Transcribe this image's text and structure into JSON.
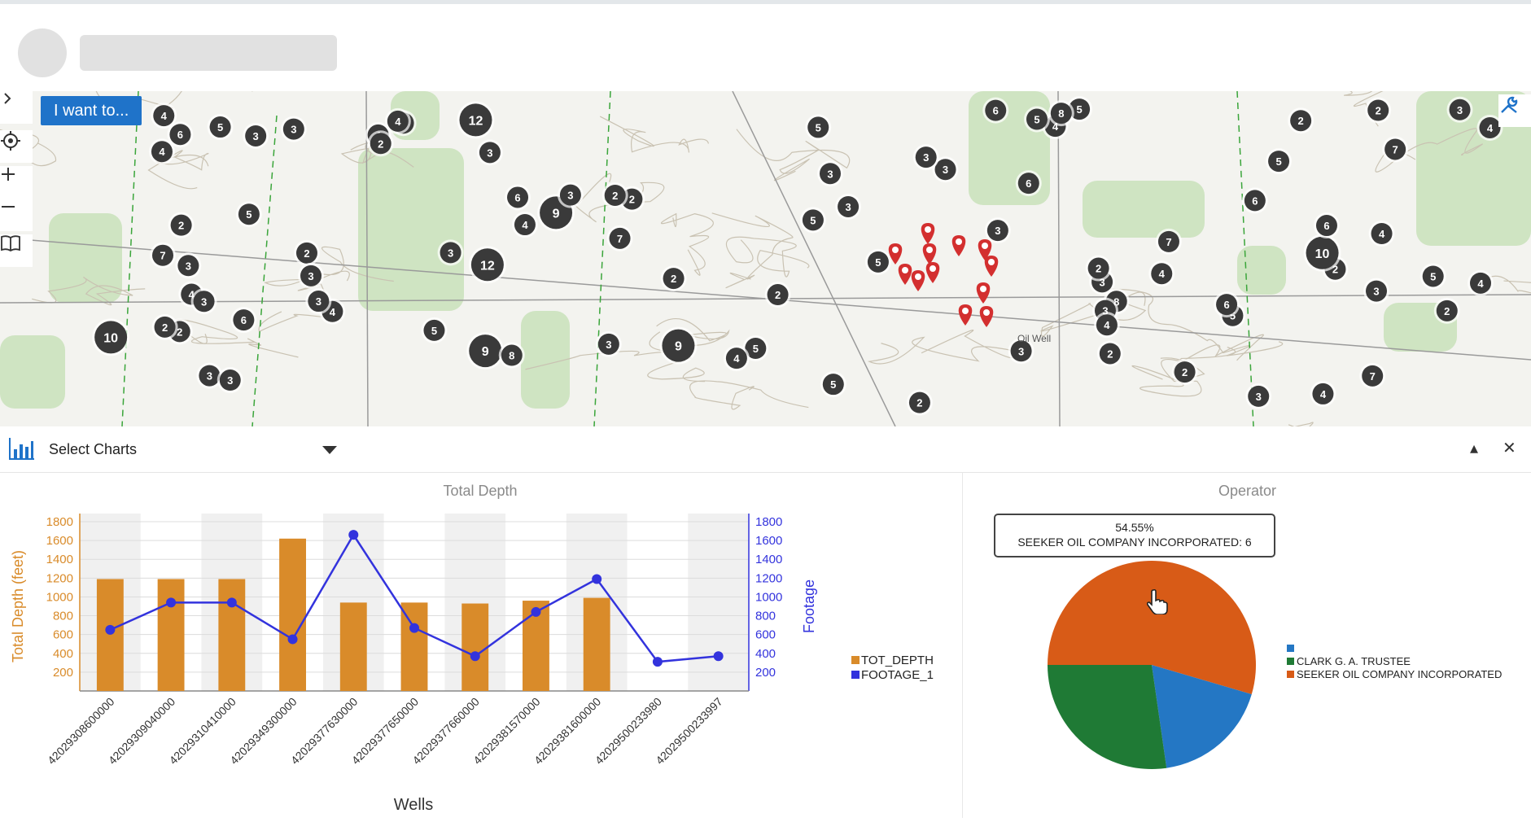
{
  "map": {
    "button_label": "I want to...",
    "expand_icon": "chevron-right-icon",
    "locate_icon": "locate-icon",
    "zoom_in_icon": "plus-icon",
    "zoom_out_icon": "minus-icon",
    "bookmark_icon": "book-icon",
    "tools_icon": "tools-icon",
    "clusters": [
      "3",
      "2",
      "3",
      "4",
      "2",
      "2",
      "2",
      "4",
      "6",
      "2",
      "4",
      "7",
      "6",
      "7",
      "3",
      "4",
      "2",
      "5",
      "2",
      "4",
      "3",
      "2",
      "4",
      "3",
      "6",
      "4",
      "8",
      "3",
      "2",
      "7",
      "5",
      "3",
      "9",
      "12",
      "10",
      "5",
      "3",
      "2",
      "5",
      "6",
      "7",
      "5",
      "4",
      "9",
      "6",
      "5",
      "10",
      "5",
      "3",
      "2",
      "4",
      "3",
      "2",
      "2",
      "4",
      "3",
      "6",
      "4",
      "3",
      "3",
      "4",
      "3",
      "3",
      "4",
      "5",
      "5",
      "2",
      "3",
      "3",
      "2",
      "3",
      "12",
      "7",
      "3",
      "5",
      "8",
      "3",
      "9",
      "8",
      "5",
      "2",
      "3",
      "5",
      "6",
      "6",
      "5",
      "4",
      "4",
      "4",
      "3",
      "2",
      "3"
    ],
    "clusters_note": "cluster badge counts shown on map",
    "label_oil_well": "Oil Well"
  },
  "toolbar": {
    "select_label": "Select Charts",
    "minimize": "▴",
    "close": "✕"
  },
  "colors": {
    "accent_blue": "#1f73c9",
    "bar_orange": "#d98b2a",
    "line_blue": "#3333dd",
    "pie_orange": "#d85b17",
    "pie_green": "#1f7a35",
    "pie_blue": "#2477c4"
  },
  "chart_data": [
    {
      "type": "bar",
      "title": "Total Depth",
      "xlabel": "Wells",
      "ylabel": "Total Depth (feet)",
      "y2label": "Footage",
      "ylim": [
        0,
        1800
      ],
      "y2lim": [
        0,
        1800
      ],
      "yticks": [
        "200",
        "400",
        "600",
        "800",
        "1000",
        "1200",
        "1400",
        "1600",
        "1800"
      ],
      "categories": [
        "42029308600000",
        "42029309040000",
        "42029310410000",
        "42029349300000",
        "42029377630000",
        "42029377650000",
        "42029377660000",
        "42029381570000",
        "42029381600000",
        "42029500233980",
        "42029500233997"
      ],
      "series": [
        {
          "name": "TOT_DEPTH",
          "kind": "bar",
          "values": [
            1190,
            1190,
            1190,
            1620,
            940,
            940,
            930,
            960,
            990,
            null,
            null
          ]
        },
        {
          "name": "FOOTAGE_1",
          "kind": "line",
          "values": [
            650,
            940,
            940,
            550,
            1660,
            670,
            370,
            840,
            1190,
            310,
            370
          ]
        }
      ],
      "legend_position": "right"
    },
    {
      "type": "pie",
      "title": "Operator",
      "tooltip_percent": "54.55%",
      "tooltip_label": "SEEKER OIL COMPANY INCORPORATED: 6",
      "slices": [
        {
          "label": "",
          "value": 2,
          "color": "#2477c4"
        },
        {
          "label": "CLARK G. A. TRUSTEE",
          "value": 3,
          "color": "#1f7a35"
        },
        {
          "label": "SEEKER OIL COMPANY INCORPORATED",
          "value": 6,
          "color": "#d85b17"
        }
      ],
      "legend_position": "right"
    }
  ]
}
